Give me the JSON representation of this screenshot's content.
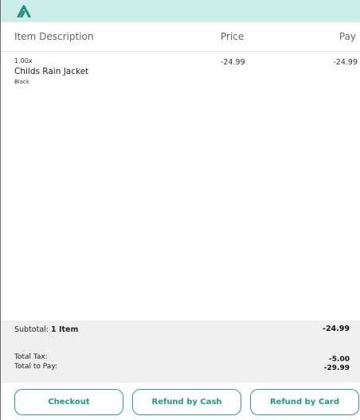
{
  "app": {
    "logo_icon": "caret-up-logo-icon",
    "accent_color": "#2aa58d",
    "topbar_color": "#cdeee8"
  },
  "table": {
    "headers": {
      "description": "Item Description",
      "price": "Price",
      "pay": "Pay"
    },
    "items": [
      {
        "quantity": "1.00x",
        "name": "Childs Rain Jacket",
        "variant": "Black",
        "price": "-24.99",
        "pay": "-24.99"
      }
    ]
  },
  "summary": {
    "subtotal_label": "Subtotal:",
    "subtotal_count": "1 Item",
    "subtotal_value": "-24.99",
    "tax_label": "Total Tax:",
    "tax_value": "-5.00",
    "total_label": "Total to Pay:",
    "total_value": "-29.99"
  },
  "actions": {
    "checkout": "Checkout",
    "refund_cash": "Refund by Cash",
    "refund_card": "Refund by Card"
  }
}
